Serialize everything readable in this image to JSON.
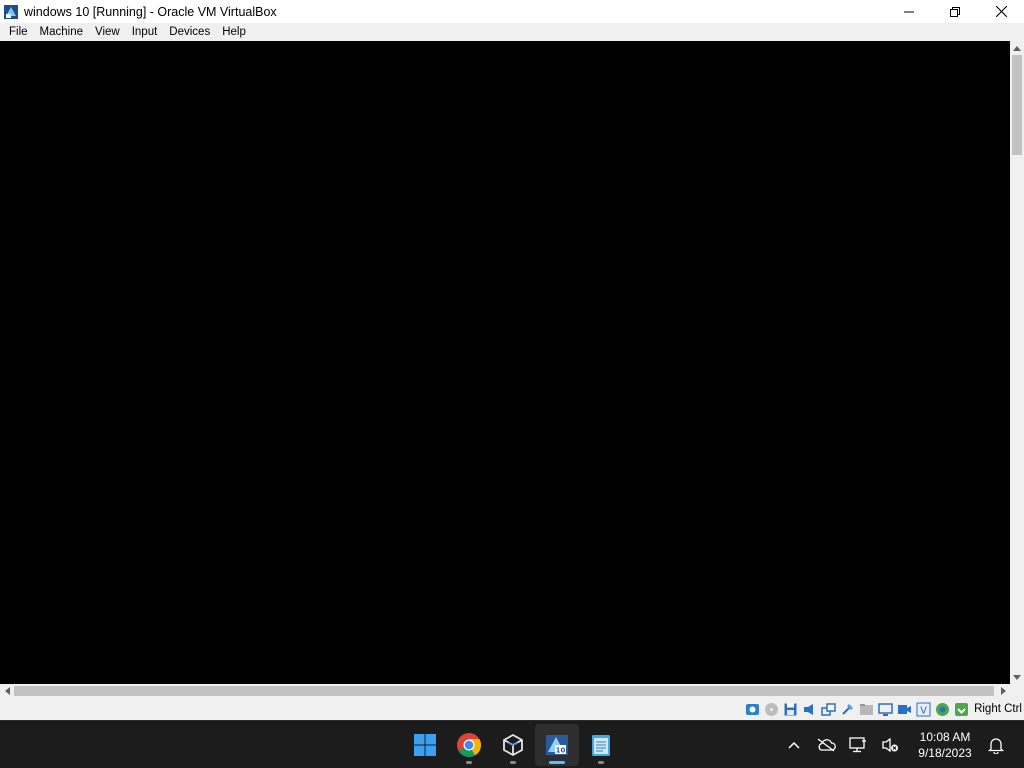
{
  "window": {
    "title": "windows 10 [Running] - Oracle VM VirtualBox",
    "app_icon": "virtualbox-icon",
    "controls": [
      "minimize-icon",
      "maximize-icon",
      "close-icon"
    ]
  },
  "menubar": {
    "items": [
      "File",
      "Machine",
      "View",
      "Input",
      "Devices",
      "Help"
    ]
  },
  "statusbar": {
    "icons": [
      "hard-disk-icon",
      "optical-drive-icon",
      "floppy-icon",
      "audio-icon",
      "network-icon",
      "usb-icon",
      "shared-folders-icon",
      "display-icon",
      "recording-icon",
      "virtualization-icon",
      "guest-additions-icon",
      "mouse-integration-icon",
      "keyboard-icon"
    ],
    "host_key": "Right Ctrl"
  },
  "taskbar": {
    "apps": [
      {
        "name": "windows-start-icon",
        "active": false,
        "running": false
      },
      {
        "name": "chrome-icon",
        "active": false,
        "running": true
      },
      {
        "name": "virtualbox-manager-icon",
        "active": false,
        "running": true
      },
      {
        "name": "virtualbox-vm-icon",
        "active": true,
        "running": true
      },
      {
        "name": "notepad-icon",
        "active": false,
        "running": true
      }
    ],
    "tray_icons": [
      "chevron-up-icon",
      "onedrive-offline-icon",
      "network-icon",
      "volume-muted-icon"
    ],
    "clock": {
      "time": "10:08 AM",
      "date": "9/18/2023"
    },
    "notification_icon": "bell-icon",
    "colors": {
      "taskbar_bg": "#1c1c1c",
      "active_indicator": "#4cc2ff",
      "windows_blue": "#0a84ff"
    }
  }
}
